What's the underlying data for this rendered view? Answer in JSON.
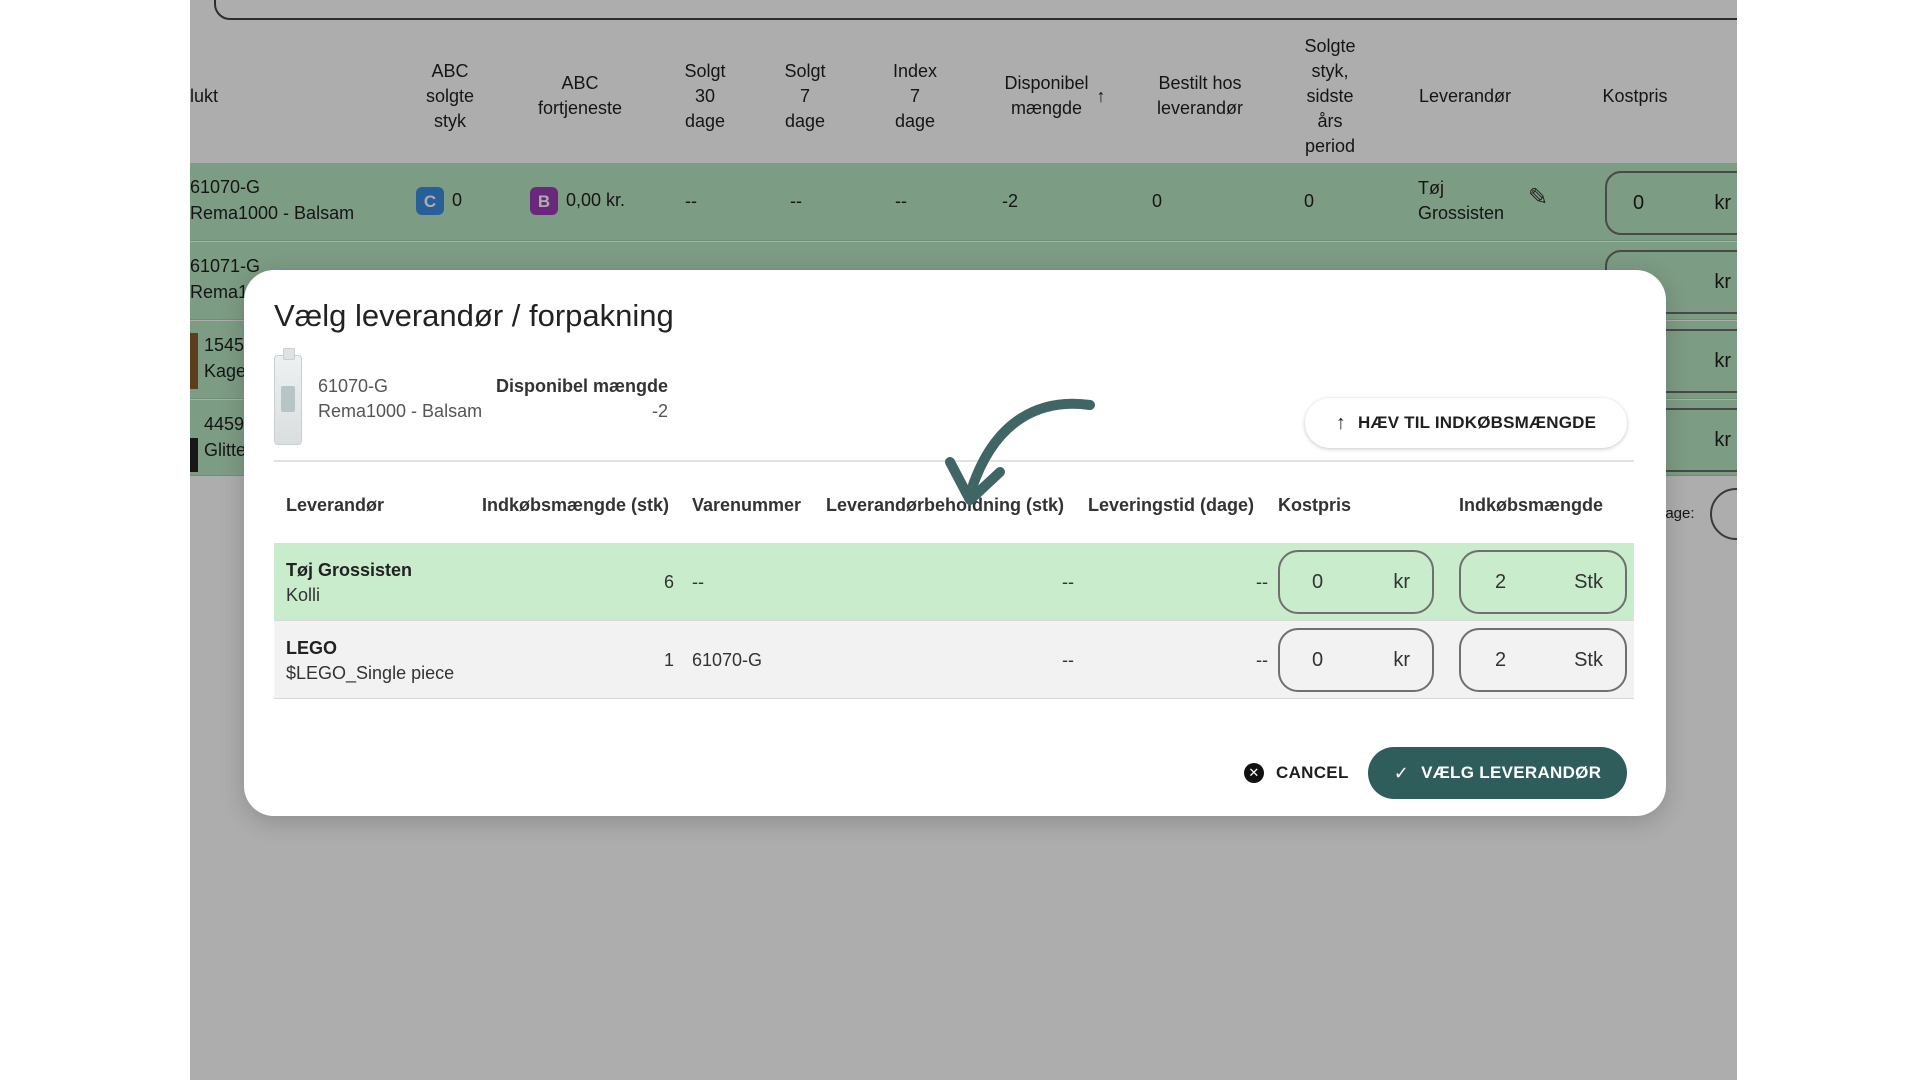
{
  "table": {
    "headers": [
      "lukt",
      "ABC\nsolgte\nstyk",
      "ABC\nfortjeneste",
      "Solgt\n30\ndage",
      "Solgt\n7\ndage",
      "Index\n7\ndage",
      "Disponibel\nmængde",
      "Bestilt hos\nleverandør",
      "Solgte\nstyk,\nsidste\nårs\nperiod",
      "Leverandør",
      "Kostpris"
    ],
    "sort_icon": "↑",
    "rows": [
      {
        "sku": "61070-G",
        "name": "Rema1000 - Balsam",
        "abc_sold_grade": "C",
        "abc_sold_value": "0",
        "abc_profit_grade": "B",
        "abc_profit_value": "0,00 kr.",
        "sold30": "--",
        "sold7": "--",
        "index7": "--",
        "available": "-2",
        "ordered": "0",
        "sold_last_year": "0",
        "supplier_line1": "Tøj",
        "supplier_line2": "Grossisten",
        "cost_value": "0",
        "cost_unit": "kr"
      },
      {
        "sku": "61071-G",
        "name": "Rema1",
        "cost_unit": "kr"
      },
      {
        "sku": "1545",
        "name": "Kage",
        "cost_unit": "kr"
      },
      {
        "sku": "4459",
        "name": "Glitte",
        "cost_unit": "kr"
      }
    ],
    "pagination_label": "page:"
  },
  "dialog": {
    "title": "Vælg leverandør / forpakning",
    "product": {
      "sku": "61070-G",
      "name": "Rema1000 - Balsam",
      "available_label": "Disponibel mængde",
      "available_value": "-2"
    },
    "raise_button": "HÆV TIL INDKØBSMÆNGDE",
    "columns": {
      "supplier": "Leverandør",
      "purchase_qty_stk": "Indkøbsmængde (stk)",
      "item_number": "Varenummer",
      "supplier_stock": "Leverandørbeholdning (stk)",
      "delivery_time": "Leveringstid (dage)",
      "cost": "Kostpris",
      "purchase_qty": "Indkøbsmængde"
    },
    "rows": [
      {
        "supplier": "Tøj Grossisten",
        "package": "Kolli",
        "purchase_qty_stk": "6",
        "item_number": "--",
        "supplier_stock": "--",
        "delivery_time": "--",
        "cost_value": "0",
        "cost_unit": "kr",
        "qty_value": "2",
        "qty_unit": "Stk"
      },
      {
        "supplier": "LEGO",
        "package": "$LEGO_Single piece",
        "purchase_qty_stk": "1",
        "item_number": "61070-G",
        "supplier_stock": "--",
        "delivery_time": "--",
        "cost_value": "0",
        "cost_unit": "kr",
        "qty_value": "2",
        "qty_unit": "Stk"
      }
    ],
    "cancel_button": "CANCEL",
    "select_button": "VÆLG LEVERANDØR"
  },
  "colors": {
    "selected_row": "#c8eccc",
    "primary_button": "#2f5d5b",
    "annotation_arrow": "#3f6664",
    "badge_c": "#3d8de0",
    "badge_b": "#9b3bb7"
  },
  "icons": {
    "raise": "arrow-up-icon",
    "cancel": "close-circle-icon",
    "select": "check-icon",
    "edit": "pencil-icon",
    "sort": "arrow-up-icon"
  }
}
